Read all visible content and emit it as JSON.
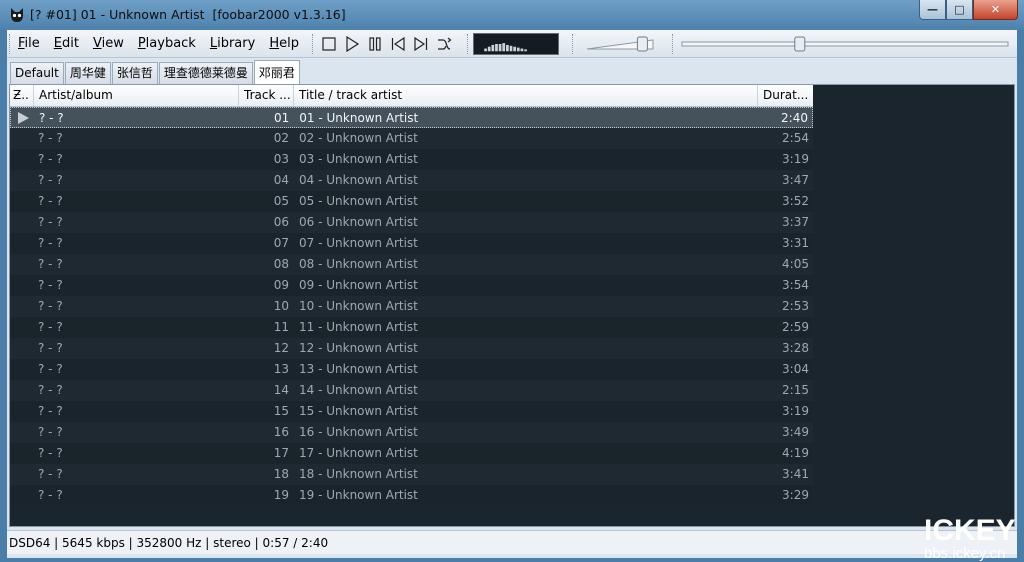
{
  "window": {
    "title": "[? #01] 01 - Unknown Artist  [foobar2000 v1.3.16]"
  },
  "menu": [
    {
      "label": "File",
      "key": "F",
      "rest": "ile"
    },
    {
      "label": "Edit",
      "key": "E",
      "rest": "dit"
    },
    {
      "label": "View",
      "key": "V",
      "rest": "iew"
    },
    {
      "label": "Playback",
      "key": "P",
      "rest": "layback"
    },
    {
      "label": "Library",
      "key": "L",
      "rest": "ibrary"
    },
    {
      "label": "Help",
      "key": "H",
      "rest": "elp"
    }
  ],
  "controls": [
    "stop-icon",
    "play-icon",
    "pause-icon",
    "previous-icon",
    "next-icon",
    "random-icon"
  ],
  "tabs": [
    {
      "label": "Default",
      "active": false
    },
    {
      "label": "周华健",
      "active": false
    },
    {
      "label": "张信哲",
      "active": false
    },
    {
      "label": "理查德德莱德曼",
      "active": false
    },
    {
      "label": "邓丽君",
      "active": true
    }
  ],
  "columns": {
    "playing": "Ƶ..",
    "artist": "Artist/album",
    "track": "Track ...",
    "title": "Title / track artist",
    "duration": "Durat..."
  },
  "rows": [
    {
      "artist": "? - ?",
      "track": "01",
      "title": "01 - Unknown Artist",
      "duration": "2:40",
      "playing": true
    },
    {
      "artist": "? - ?",
      "track": "02",
      "title": "02 - Unknown Artist",
      "duration": "2:54"
    },
    {
      "artist": "? - ?",
      "track": "03",
      "title": "03 - Unknown Artist",
      "duration": "3:19"
    },
    {
      "artist": "? - ?",
      "track": "04",
      "title": "04 - Unknown Artist",
      "duration": "3:47"
    },
    {
      "artist": "? - ?",
      "track": "05",
      "title": "05 - Unknown Artist",
      "duration": "3:52"
    },
    {
      "artist": "? - ?",
      "track": "06",
      "title": "06 - Unknown Artist",
      "duration": "3:37"
    },
    {
      "artist": "? - ?",
      "track": "07",
      "title": "07 - Unknown Artist",
      "duration": "3:31"
    },
    {
      "artist": "? - ?",
      "track": "08",
      "title": "08 - Unknown Artist",
      "duration": "4:05"
    },
    {
      "artist": "? - ?",
      "track": "09",
      "title": "09 - Unknown Artist",
      "duration": "3:54"
    },
    {
      "artist": "? - ?",
      "track": "10",
      "title": "10 - Unknown Artist",
      "duration": "2:53"
    },
    {
      "artist": "? - ?",
      "track": "11",
      "title": "11 - Unknown Artist",
      "duration": "2:59"
    },
    {
      "artist": "? - ?",
      "track": "12",
      "title": "12 - Unknown Artist",
      "duration": "3:28"
    },
    {
      "artist": "? - ?",
      "track": "13",
      "title": "13 - Unknown Artist",
      "duration": "3:04"
    },
    {
      "artist": "? - ?",
      "track": "14",
      "title": "14 - Unknown Artist",
      "duration": "2:15"
    },
    {
      "artist": "? - ?",
      "track": "15",
      "title": "15 - Unknown Artist",
      "duration": "3:19"
    },
    {
      "artist": "? - ?",
      "track": "16",
      "title": "16 - Unknown Artist",
      "duration": "3:49"
    },
    {
      "artist": "? - ?",
      "track": "17",
      "title": "17 - Unknown Artist",
      "duration": "4:19"
    },
    {
      "artist": "? - ?",
      "track": "18",
      "title": "18 - Unknown Artist",
      "duration": "3:41"
    },
    {
      "artist": "? - ?",
      "track": "19",
      "title": "19 - Unknown Artist",
      "duration": "3:29"
    }
  ],
  "status": "DSD64 | 5645 kbps | 352800 Hz | stereo | 0:57 / 2:40",
  "volume_level": 0.9,
  "seek_fraction": 0.356,
  "watermark": {
    "brand": "ICKEY",
    "url": "bbs.ickey.cn"
  },
  "colors": {
    "playlist_bg": "#1b252d",
    "row_text": "#9ea8b0",
    "selected_row": "#45525c",
    "title_bar": "#5b8db8"
  }
}
